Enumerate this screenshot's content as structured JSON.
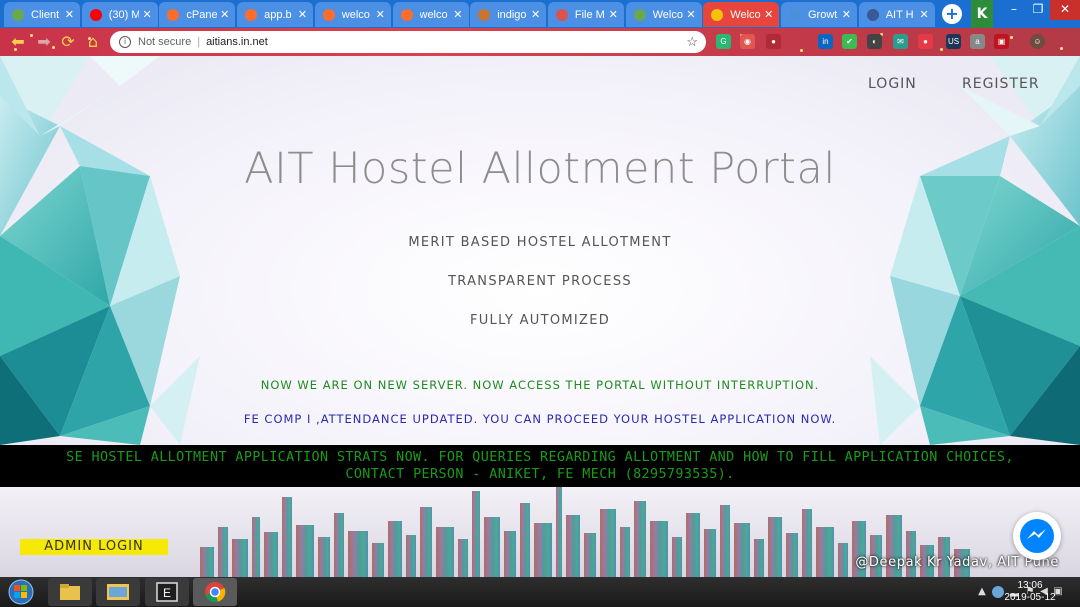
{
  "browser": {
    "tabs": [
      {
        "title": "Client",
        "favicon_color": "#6aa84f"
      },
      {
        "title": "(30) M",
        "favicon_color": "#ff0000"
      },
      {
        "title": "cPanel",
        "favicon_color": "#ff6c2c"
      },
      {
        "title": "app.b",
        "favicon_color": "#ff6c2c"
      },
      {
        "title": "welco",
        "favicon_color": "#ff6c2c"
      },
      {
        "title": "welco",
        "favicon_color": "#ff6c2c"
      },
      {
        "title": "indigo",
        "favicon_color": "#c87533"
      },
      {
        "title": "File M",
        "favicon_color": "#d9534f"
      },
      {
        "title": "Welco",
        "favicon_color": "#6aa84f"
      },
      {
        "title": "Welco",
        "favicon_color": "#f4c20d",
        "active": true
      },
      {
        "title": "Growt",
        "favicon_color": "#4a90d9"
      },
      {
        "title": "AIT H",
        "favicon_color": "#3b5998"
      }
    ],
    "window_controls": {
      "minimize": "–",
      "maximize": "❐",
      "close": "✕"
    },
    "address": {
      "security_label": "Not secure",
      "url": "aitians.in.net"
    }
  },
  "page": {
    "nav": {
      "login": "LOGIN",
      "register": "REGISTER"
    },
    "title": "AIT Hostel Allotment Portal",
    "features": [
      "MERIT BASED HOSTEL ALLOTMENT",
      "TRANSPARENT PROCESS",
      "FULLY AUTOMIZED"
    ],
    "notice_server": "NOW WE ARE ON NEW SERVER. NOW ACCESS THE PORTAL WITHOUT INTERRUPTION.",
    "notice_attendance": "FE COMP I ,ATTENDANCE UPDATED. YOU CAN PROCEED YOUR HOSTEL APPLICATION NOW.",
    "banner": "SE HOSTEL ALLOTMENT APPLICATION STRATS NOW. FOR QUERIES REGARDING ALLOTMENT AND HOW TO FILL APPLICATION CHOICES, CONTACT PERSON - ANIKET, FE MECH (8295793535).",
    "admin_login": "ADMIN LOGIN",
    "credit": "@Deepak Kr Yadav, AIT Pune"
  },
  "taskbar": {
    "time": "13:06",
    "date": "2019-05-12"
  },
  "colors": {
    "notice_server": "#1f8a1f",
    "notice_attendance": "#2a2ab0",
    "banner_text": "#1a9b1a",
    "admin_button": "#f5e905"
  }
}
